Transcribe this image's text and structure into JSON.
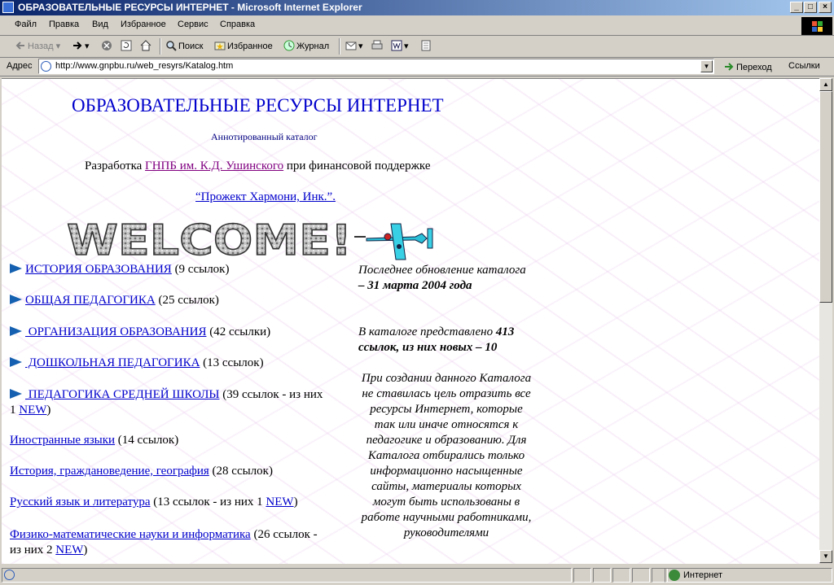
{
  "window": {
    "title": "ОБРАЗОВАТЕЛЬНЫЕ РЕСУРСЫ ИНТЕРНЕТ - Microsoft Internet Explorer",
    "minimize": "_",
    "maximize": "□",
    "close": "×"
  },
  "menu": {
    "items": [
      "Файл",
      "Правка",
      "Вид",
      "Избранное",
      "Сервис",
      "Справка"
    ]
  },
  "toolbar": {
    "back": "Назад",
    "search": "Поиск",
    "favorites": "Избранное",
    "journal": "Журнал"
  },
  "address": {
    "label": "Адрес",
    "url": "http://www.gnpbu.ru/web_resyrs/Katalog.htm",
    "go": "Переход",
    "links": "Ссылки"
  },
  "page": {
    "heading": "ОБРАЗОВАТЕЛЬНЫЕ РЕСУРСЫ ИНТЕРНЕТ",
    "subheading": "Аннотированный каталог",
    "dev_prefix": "Разработка ",
    "dev_link": "ГНПБ им. К.Д. Ушинского",
    "dev_suffix": " при финансовой поддержке",
    "harmony_link": "“Прожект Хармони, Инк.”.",
    "welcome": "WELCOME!",
    "categories": [
      {
        "link": "ИСТОРИЯ ОБРАЗОВАНИЯ",
        "count": " (9 ссылок)",
        "arrow": true
      },
      {
        "link": "ОБЩАЯ ПЕДАГОГИКА",
        "count": " (25 ссылок)",
        "arrow": true
      },
      {
        "link": " ОРГАНИЗАЦИЯ ОБРАЗОВАНИЯ",
        "count": " (42 ссылки)",
        "arrow": true
      },
      {
        "link": " ДОШКОЛЬНАЯ ПЕДАГОГИКА",
        "count": " (13 ссылок)",
        "arrow": true
      },
      {
        "link": " ПЕДАГОГИКА СРЕДНЕЙ ШКОЛЫ",
        "count": " (39 ссылок - из них",
        "count2": "1 ",
        "new": "NEW",
        "close": ")",
        "arrow": true
      },
      {
        "link": "Иностранные языки",
        "count": " (14 ссылок)"
      },
      {
        "link": "История, граждановедение, география",
        "count": " (28 ссылок)"
      },
      {
        "link": "Русский язык и литература",
        "count": " (13 ссылок - из них 1 ",
        "new": "NEW",
        "close": ")"
      },
      {
        "link": "Физико-математические науки и информатика",
        "count": " (26 ссылок -",
        "count2": "из них 2 ",
        "new": "NEW",
        "close": ")"
      }
    ],
    "update_prefix": "Последнее обновление каталога ",
    "update_date": "– 31  марта   2004 года",
    "catalog_prefix": "В каталоге представлено ",
    "catalog_count": "413 ссылок, из них новых – 10",
    "about": "При создании данного Каталога не ставилась цель отразить все ресурсы Интернет, которые так или иначе относятся к педагогике и образованию. Для Каталога отбирались только информационно насыщенные сайты, материалы которых могут быть использованы в работе научными работниками, руководителями"
  },
  "status": {
    "zone": "Интернет"
  },
  "colors": {
    "link": "#0000cc",
    "visited": "#800080",
    "new": "#cc0000",
    "titlebar": "#0a246a"
  }
}
